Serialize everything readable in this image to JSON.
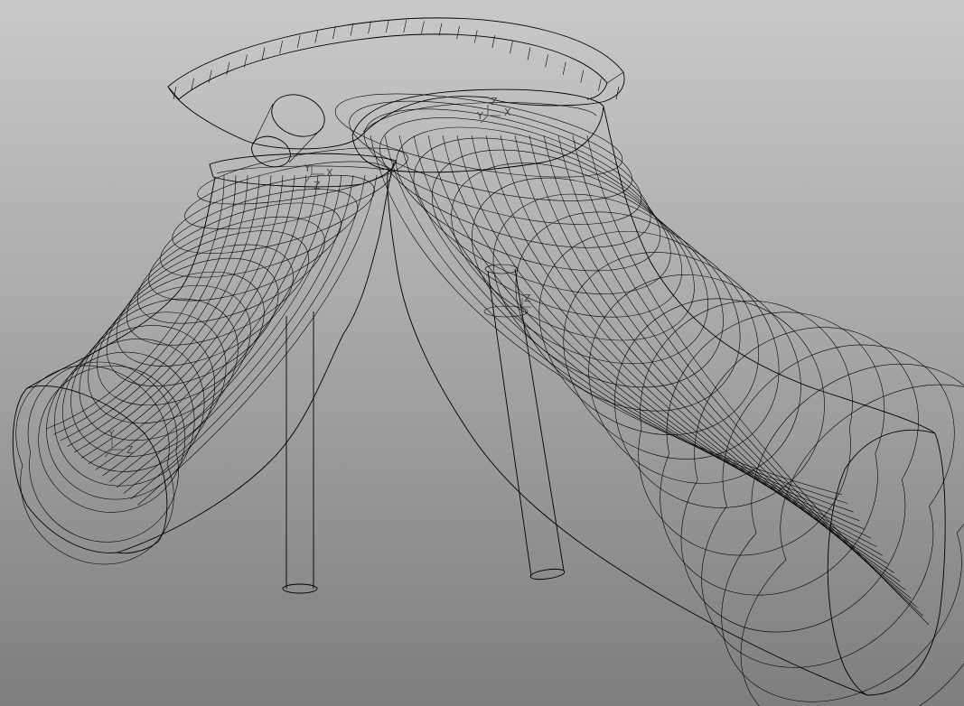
{
  "viewport": {
    "background_top": "#c9c9c9",
    "background_bottom": "#7e7e7e",
    "line_color": "#000000",
    "triad_color": "#555555"
  },
  "triads": [
    {
      "name": "triad-top-right",
      "labels": [
        "Z",
        "Y",
        "X"
      ]
    },
    {
      "name": "triad-top-left",
      "labels": [
        "Y",
        "X",
        "Z"
      ]
    },
    {
      "name": "triad-left-pipe",
      "labels": [
        "Y",
        "Z"
      ]
    },
    {
      "name": "triad-center",
      "labels": [
        "Z"
      ]
    }
  ]
}
